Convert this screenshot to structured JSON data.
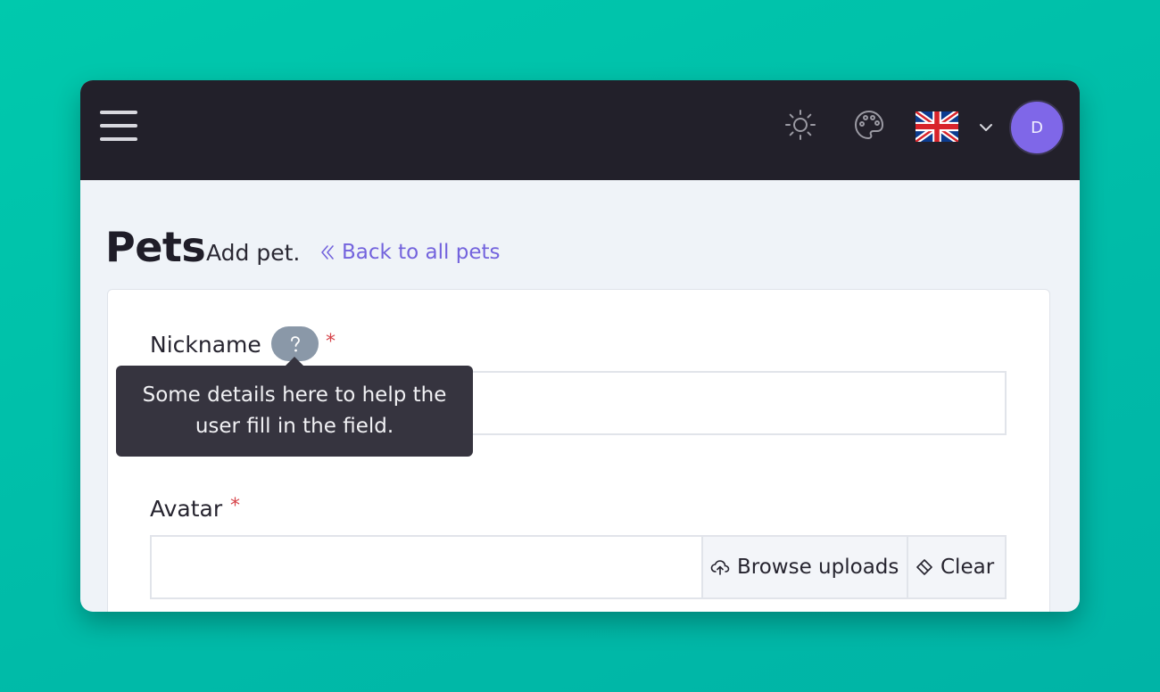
{
  "topbar": {
    "menu_icon": "hamburger-menu-icon",
    "theme_icon": "sun-icon",
    "palette_icon": "palette-icon",
    "language_flag": "uk-flag-icon",
    "language_chevron": "chevron-down-icon",
    "avatar_initial": "D"
  },
  "page": {
    "title": "Pets",
    "subtitle": "Add pet.",
    "back_link": "Back to all pets",
    "back_icon": "double-chevron-left-icon"
  },
  "form": {
    "nickname": {
      "label": "Nickname",
      "required_mark": "*",
      "help_icon": "question-mark-icon",
      "value": "",
      "tooltip_line1": "Some details here to help the",
      "tooltip_line2": "user fill in the field."
    },
    "avatar": {
      "label": "Avatar",
      "required_mark": "*",
      "value": "",
      "browse_label": "Browse uploads",
      "browse_icon": "cloud-upload-icon",
      "clear_label": "Clear",
      "clear_icon": "eraser-icon"
    }
  },
  "colors": {
    "accent": "#7363dd",
    "topbar": "#22202a",
    "avatar_bg": "#7f67e8",
    "required": "#d6444a",
    "tooltip_bg": "#36343f"
  }
}
